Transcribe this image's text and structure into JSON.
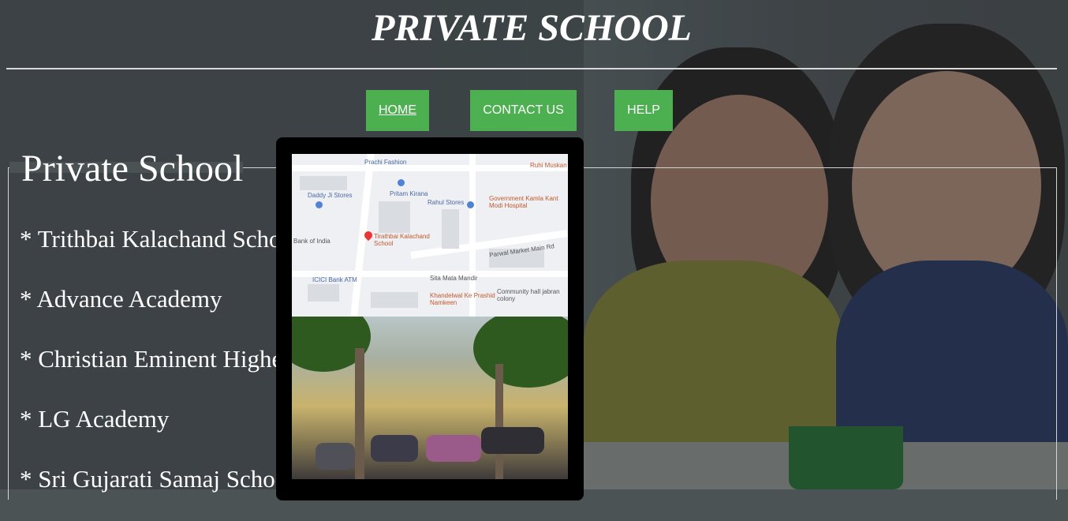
{
  "header": {
    "title": "PRIVATE SCHOOL"
  },
  "nav": {
    "home": "HOME",
    "contact": "CONTACT US",
    "help": "HELP"
  },
  "section": {
    "legend": "Private School",
    "schools": [
      "* Trithbai Kalachand School",
      "* Advance Academy",
      "* Christian Eminent Higher",
      "* LG Academy",
      "* Sri Gujarati Samaj School"
    ]
  },
  "map": {
    "labels": [
      "Prachi Fashion",
      "Ruhi Muskan",
      "Daddy Ji Stores",
      "Pritam Kirana",
      "Rahul Stores",
      "Government Kamla Kant Modi Hospital",
      "Bank of India",
      "Tirathbai Kalachand School",
      "Parwal Market Main Rd",
      "ICICI Bank ATM",
      "Sita Mata Mandir",
      "Khandelwal Ke Prashid Namkeen",
      "Community hall jabran colony"
    ]
  },
  "colors": {
    "nav_green": "#4caf50",
    "popup_bg": "#000000"
  }
}
